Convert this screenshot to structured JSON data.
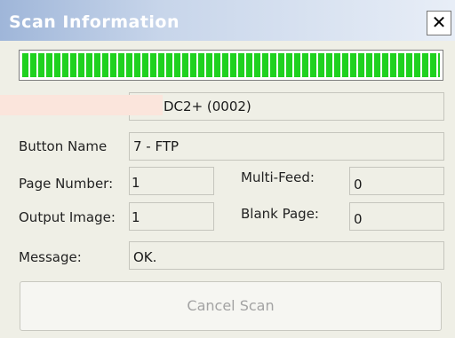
{
  "window": {
    "title": "Scan Information",
    "close_glyph": "✕"
  },
  "progress": {
    "fraction": 1.0,
    "color": "#1fd11f"
  },
  "fields": {
    "scanner_label": "",
    "scanner_value": "DC2+ (0002)",
    "button_name_label": "Button Name",
    "button_name_value": "7 - FTP",
    "page_number_label": "Page Number:",
    "page_number_value": "1",
    "multi_feed_label": "Multi-Feed:",
    "multi_feed_value": "0",
    "output_image_label": "Output Image:",
    "output_image_value": "1",
    "blank_page_label": "Blank Page:",
    "blank_page_value": "0",
    "message_label": "Message:",
    "message_value": "OK."
  },
  "actions": {
    "cancel_label": "Cancel Scan"
  }
}
